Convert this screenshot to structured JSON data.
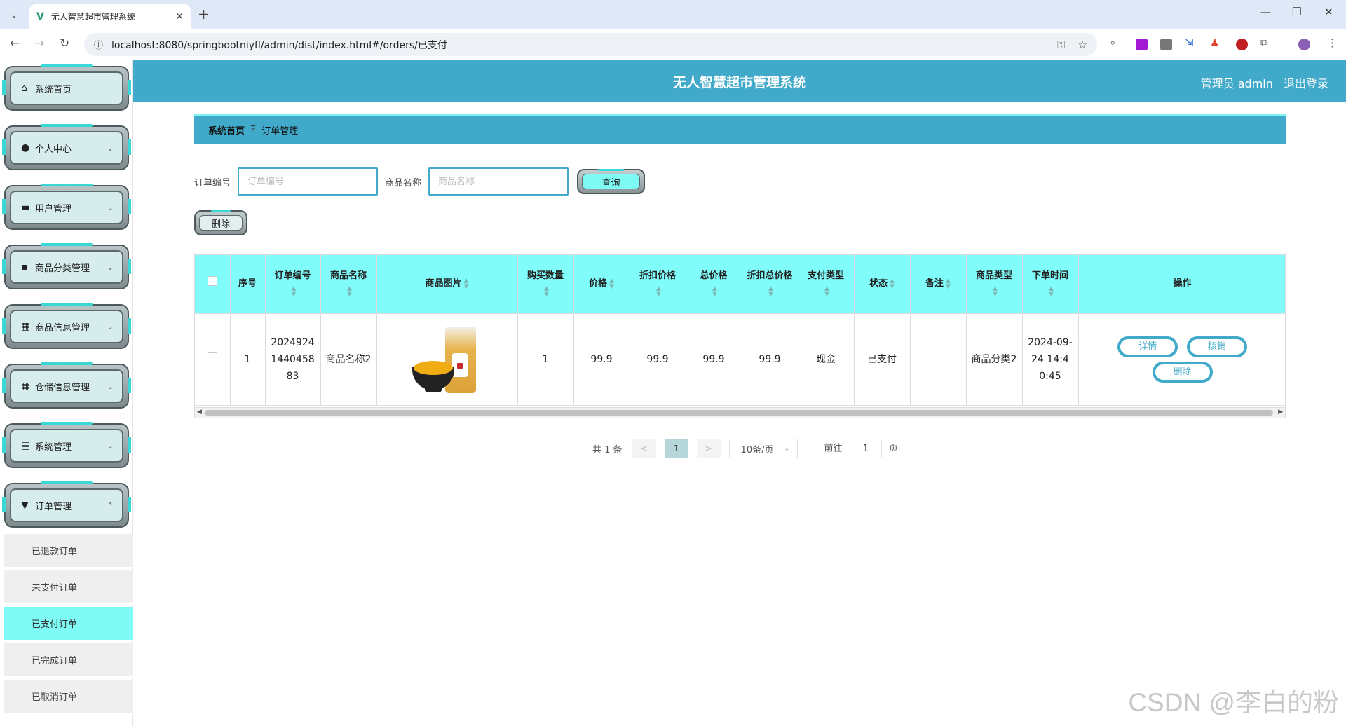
{
  "browser": {
    "tab_title": "无人智慧超市管理系统",
    "url": "localhost:8080/springbootniyfl/admin/dist/index.html#/orders/已支付"
  },
  "app": {
    "title": "无人智慧超市管理系统",
    "user_label": "管理员 admin",
    "logout_label": "退出登录"
  },
  "sidebar": {
    "items": [
      {
        "label": "系统首页",
        "icon": "home-icon"
      },
      {
        "label": "个人中心",
        "icon": "user-icon"
      },
      {
        "label": "用户管理",
        "icon": "briefcase-icon"
      },
      {
        "label": "商品分类管理",
        "icon": "chat-icon"
      },
      {
        "label": "商品信息管理",
        "icon": "grid-icon"
      },
      {
        "label": "仓储信息管理",
        "icon": "grid-icon"
      },
      {
        "label": "系统管理",
        "icon": "clipboard-icon"
      },
      {
        "label": "订单管理",
        "icon": "pin-icon"
      }
    ],
    "sub_items": [
      "已退款订单",
      "未支付订单",
      "已支付订单",
      "已完成订单",
      "已取消订单"
    ],
    "active_sub": "已支付订单"
  },
  "breadcrumb": {
    "home": "系统首页",
    "separator": "Ξ",
    "current": "订单管理"
  },
  "search": {
    "order_no_label": "订单编号",
    "order_no_placeholder": "订单编号",
    "product_label": "商品名称",
    "product_placeholder": "商品名称",
    "query_button": "查询"
  },
  "actions": {
    "delete_button": "删除"
  },
  "table": {
    "columns": [
      "序号",
      "订单编号",
      "商品名称",
      "商品图片",
      "购买数量",
      "价格",
      "折扣价格",
      "总价格",
      "折扣总价格",
      "支付类型",
      "状态",
      "备注",
      "商品类型",
      "下单时间",
      "操作"
    ],
    "rows": [
      {
        "index": "1",
        "order_no": "20249241440458 83",
        "product_name": "商品名称2",
        "quantity": "1",
        "price": "99.9",
        "discount_price": "99.9",
        "total_price": "99.9",
        "discount_total": "99.9",
        "pay_type": "现金",
        "status": "已支付",
        "remark": "",
        "product_type": "商品分类2",
        "order_time": "2024-09-24 14:40:45"
      }
    ],
    "row_actions": {
      "detail": "详情",
      "verify": "核销",
      "delete": "删除"
    }
  },
  "pagination": {
    "total_text": "共 1 条",
    "prev": "<",
    "current_page": "1",
    "next": ">",
    "page_size": "10条/页",
    "goto_label": "前往",
    "goto_value": "1",
    "page_suffix": "页"
  },
  "watermark": "CSDN @李白的粉"
}
